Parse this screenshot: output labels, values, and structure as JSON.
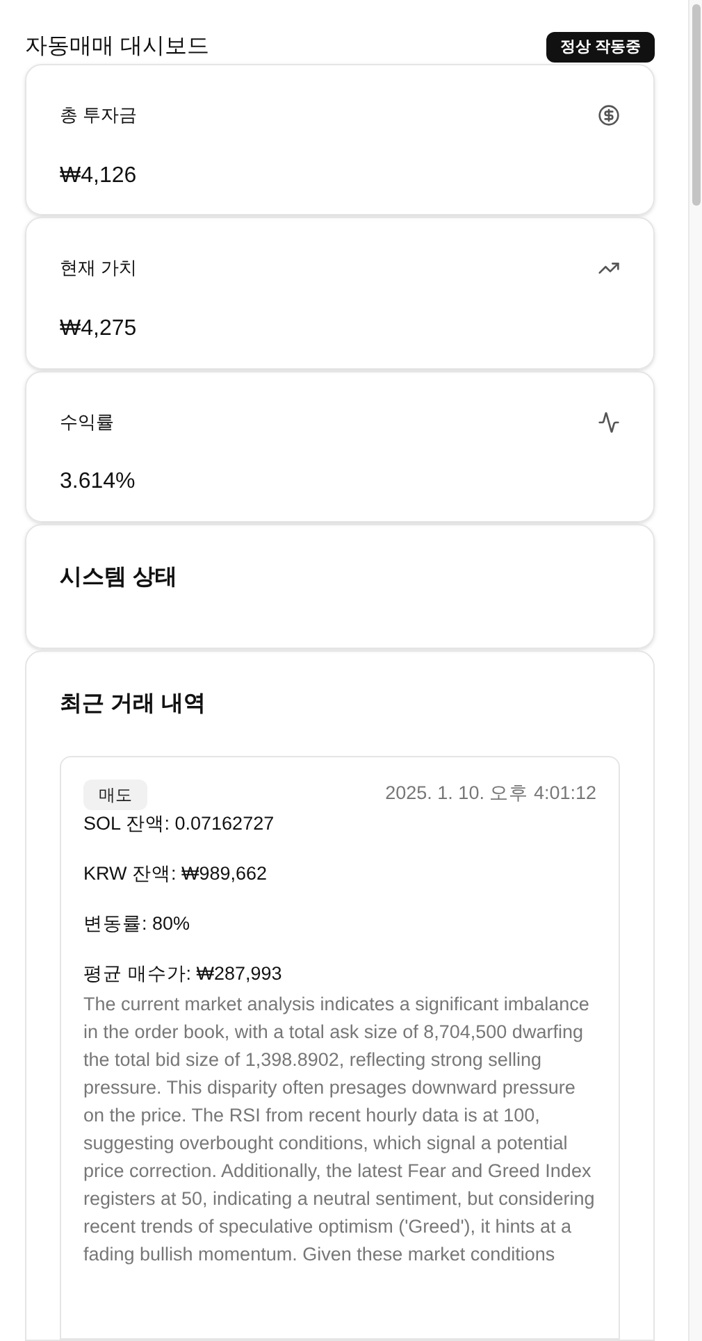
{
  "header": {
    "title": "자동매매 대시보드",
    "status_badge": "정상 작동중"
  },
  "stats": [
    {
      "label": "총 투자금",
      "value": "₩4,126",
      "kind": "dollar"
    },
    {
      "label": "현재 가치",
      "value": "₩4,275",
      "kind": "trend"
    },
    {
      "label": "수익률",
      "value": "3.614%",
      "kind": "activity"
    }
  ],
  "system_status": {
    "title": "시스템 상태"
  },
  "recent_trades": {
    "title": "최근 거래 내역",
    "trades": [
      {
        "kind": "sell",
        "type_label": "매도",
        "timestamp": "2025. 1. 10. 오후 4:01:12",
        "details": [
          "SOL 잔액: 0.07162727",
          "KRW 잔액: ₩989,662",
          "변동률: 80%",
          "평균 매수가: ₩287,993"
        ],
        "reason": "The current market analysis indicates a significant imbalance in the order book, with a total ask size of 8,704,500 dwarfing the total bid size of 1,398.8902, reflecting strong selling pressure. This disparity often presages downward pressure on the price. The RSI from recent hourly data is at 100, suggesting overbought conditions, which signal a potential price correction. Additionally, the latest Fear and Greed Index registers at 50, indicating a neutral sentiment, but considering recent trends of speculative optimism ('Greed'), it hints at a fading bullish momentum. Given these market conditions"
      }
    ]
  }
}
